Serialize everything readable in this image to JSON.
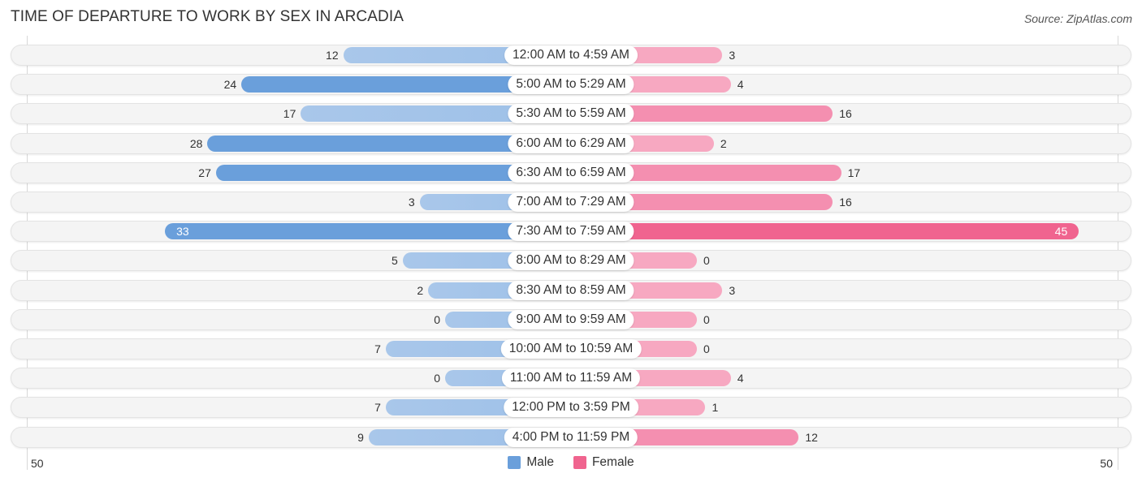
{
  "title": "TIME OF DEPARTURE TO WORK BY SEX IN ARCADIA",
  "source": "Source: ZipAtlas.com",
  "colors": {
    "male": "#6a9fdb",
    "male_light": "#a9c7ea",
    "female": "#f0648f",
    "female_light": "#f7a8c1"
  },
  "chart_data": {
    "type": "bar",
    "orientation": "horizontal-diverging",
    "title": "TIME OF DEPARTURE TO WORK BY SEX IN ARCADIA",
    "categories": [
      "12:00 AM to 4:59 AM",
      "5:00 AM to 5:29 AM",
      "5:30 AM to 5:59 AM",
      "6:00 AM to 6:29 AM",
      "6:30 AM to 6:59 AM",
      "7:00 AM to 7:29 AM",
      "7:30 AM to 7:59 AM",
      "8:00 AM to 8:29 AM",
      "8:30 AM to 8:59 AM",
      "9:00 AM to 9:59 AM",
      "10:00 AM to 10:59 AM",
      "11:00 AM to 11:59 AM",
      "12:00 PM to 3:59 PM",
      "4:00 PM to 11:59 PM"
    ],
    "series": [
      {
        "name": "Male",
        "values": [
          12,
          24,
          17,
          28,
          27,
          3,
          33,
          5,
          2,
          0,
          7,
          0,
          7,
          9
        ]
      },
      {
        "name": "Female",
        "values": [
          3,
          4,
          16,
          2,
          17,
          16,
          45,
          0,
          3,
          0,
          0,
          4,
          1,
          12
        ]
      }
    ],
    "axis": {
      "left_tick": "50",
      "right_tick": "50",
      "range": [
        0,
        50
      ]
    },
    "legend": {
      "position": "bottom-center",
      "entries": [
        "Male",
        "Female"
      ]
    },
    "xlabel": "",
    "ylabel": ""
  }
}
